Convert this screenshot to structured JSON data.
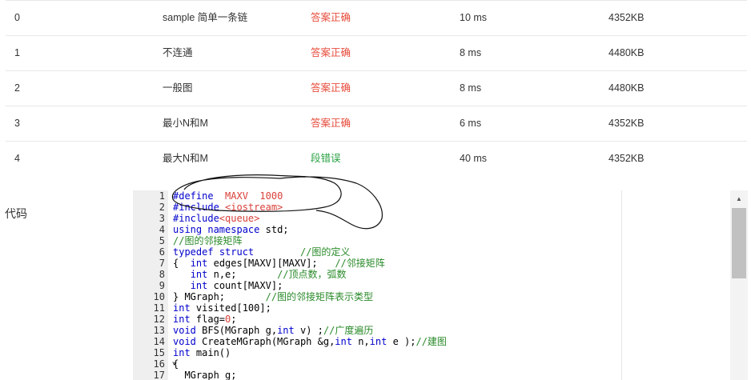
{
  "results": [
    {
      "id": "0",
      "name": "sample 简单一条链",
      "status": "答案正确",
      "status_kind": "ok",
      "time": "10 ms",
      "memory": "4352KB"
    },
    {
      "id": "1",
      "name": "不连通",
      "status": "答案正确",
      "status_kind": "ok",
      "time": "8 ms",
      "memory": "4480KB"
    },
    {
      "id": "2",
      "name": "一般图",
      "status": "答案正确",
      "status_kind": "ok",
      "time": "8 ms",
      "memory": "4480KB"
    },
    {
      "id": "3",
      "name": "最小N和M",
      "status": "答案正确",
      "status_kind": "ok",
      "time": "6 ms",
      "memory": "4352KB"
    },
    {
      "id": "4",
      "name": "最大N和M",
      "status": "段错误",
      "status_kind": "error",
      "time": "40 ms",
      "memory": "4352KB"
    }
  ],
  "code_section": {
    "label": "代码",
    "line_numbers": [
      "1",
      "2",
      "3",
      "4",
      "5",
      "6",
      "7",
      "8",
      "9",
      "10",
      "11",
      "12",
      "13",
      "14",
      "15",
      "16",
      "17"
    ],
    "code_lines": [
      {
        "a": "#define",
        "b": "  ",
        "c": "MAXV",
        "d": "  ",
        "e": "1000"
      },
      {
        "a": "#include ",
        "b": "<iostream>"
      },
      {
        "a": "#include",
        "b": "<queue>"
      },
      {
        "a": "using",
        "b": " ",
        "c": "namespace",
        "d": " std;"
      },
      {
        "a": "//图的邻接矩阵"
      },
      {
        "a": "typedef",
        "b": " ",
        "c": "struct",
        "d": "        ",
        "e": "//图的定义"
      },
      {
        "a": "{  ",
        "b": "int",
        "c": " edges[MAXV][MAXV];   ",
        "d": "//邻接矩阵"
      },
      {
        "a": "   ",
        "b": "int",
        "c": " n,e;       ",
        "d": "//顶点数，弧数"
      },
      {
        "a": "   ",
        "b": "int",
        "c": " count[MAXV];"
      },
      {
        "a": "} MGraph;       ",
        "b": "//图的邻接矩阵表示类型"
      },
      {
        "a": "int",
        "b": " visited[100];"
      },
      {
        "a": "int",
        "b": " flag=",
        "c": "0",
        "d": ";"
      },
      {
        "a": "void",
        "b": " BFS(MGraph g,",
        "c": "int",
        "d": " v) ;",
        "e": "//广度遍历"
      },
      {
        "a": "void",
        "b": " CreateMGraph(MGraph &g,",
        "c": "int",
        "d": " n,",
        "e": "int",
        "f": " e );",
        "g": "//建图"
      },
      {
        "a": "int",
        "b": " main()"
      },
      {
        "a": "{"
      },
      {
        "a": "  MGraph g;"
      }
    ]
  },
  "colors": {
    "accepted": "#e74c3c",
    "segfault": "#2ba245",
    "keyword": "#0000cc",
    "comment": "#2a8a2a",
    "gutter": "#efefef"
  },
  "icons": {
    "fold_marker": "chevron-down-icon",
    "scroll_up": "triangle-up-icon"
  }
}
